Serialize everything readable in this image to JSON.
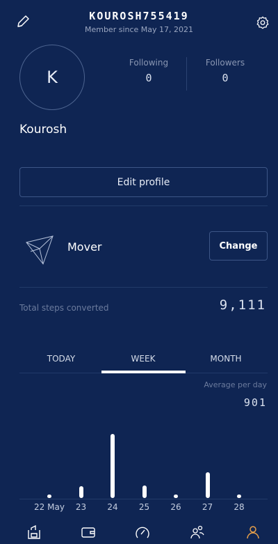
{
  "header": {
    "username": "KOUROSH755419",
    "member_since": "Member since May 17, 2021"
  },
  "profile": {
    "avatar_initial": "K",
    "name": "Kourosh",
    "following_label": "Following",
    "following_value": "0",
    "followers_label": "Followers",
    "followers_value": "0",
    "edit_label": "Edit profile"
  },
  "level": {
    "name": "Mover",
    "change_label": "Change"
  },
  "steps": {
    "label": "Total steps converted",
    "value": "9,111"
  },
  "tabs": [
    "TODAY",
    "WEEK",
    "MONTH"
  ],
  "active_tab": "WEEK",
  "average": {
    "label": "Average per day",
    "value": "901"
  },
  "chart_data": {
    "type": "bar",
    "categories": [
      "22 May",
      "23",
      "24",
      "25",
      "26",
      "27",
      "28"
    ],
    "values": [
      150,
      680,
      3700,
      720,
      20,
      1500,
      130
    ],
    "ylim": [
      0,
      3800
    ]
  },
  "bottom_nav": [
    {
      "icon": "shop-icon"
    },
    {
      "icon": "wallet-icon"
    },
    {
      "icon": "speedometer-icon"
    },
    {
      "icon": "friends-icon"
    },
    {
      "icon": "profile-icon"
    }
  ],
  "colors": {
    "background": "#0f2553",
    "accent_active": "#e8a04a"
  }
}
